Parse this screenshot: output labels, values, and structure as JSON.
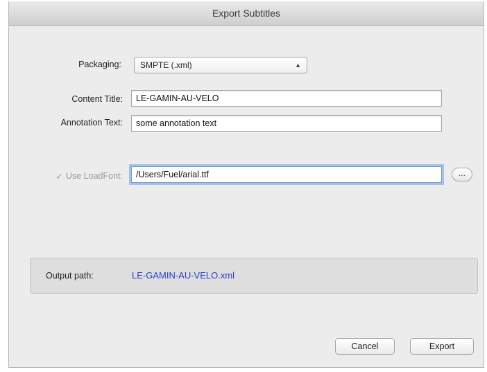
{
  "window": {
    "title": "Export Subtitles"
  },
  "form": {
    "packaging": {
      "label": "Packaging:",
      "selected": "SMPTE (.xml)",
      "arrows_icon": "up-down-arrows-icon"
    },
    "content_title": {
      "label": "Content Title:",
      "value": "LE-GAMIN-AU-VELO"
    },
    "annotation_text": {
      "label": "Annotation Text:",
      "value": "some annotation text"
    },
    "load_font": {
      "checked_glyph": "✓",
      "label": "Use LoadFont:",
      "checked": true,
      "enabled": false,
      "value": "/Users/Fuel/arial.ttf",
      "browse_label": "..."
    }
  },
  "output": {
    "label": "Output path:",
    "value": "LE-GAMIN-AU-VELO.xml",
    "value_color": "#2b3fc7"
  },
  "buttons": {
    "cancel": "Cancel",
    "export": "Export"
  }
}
